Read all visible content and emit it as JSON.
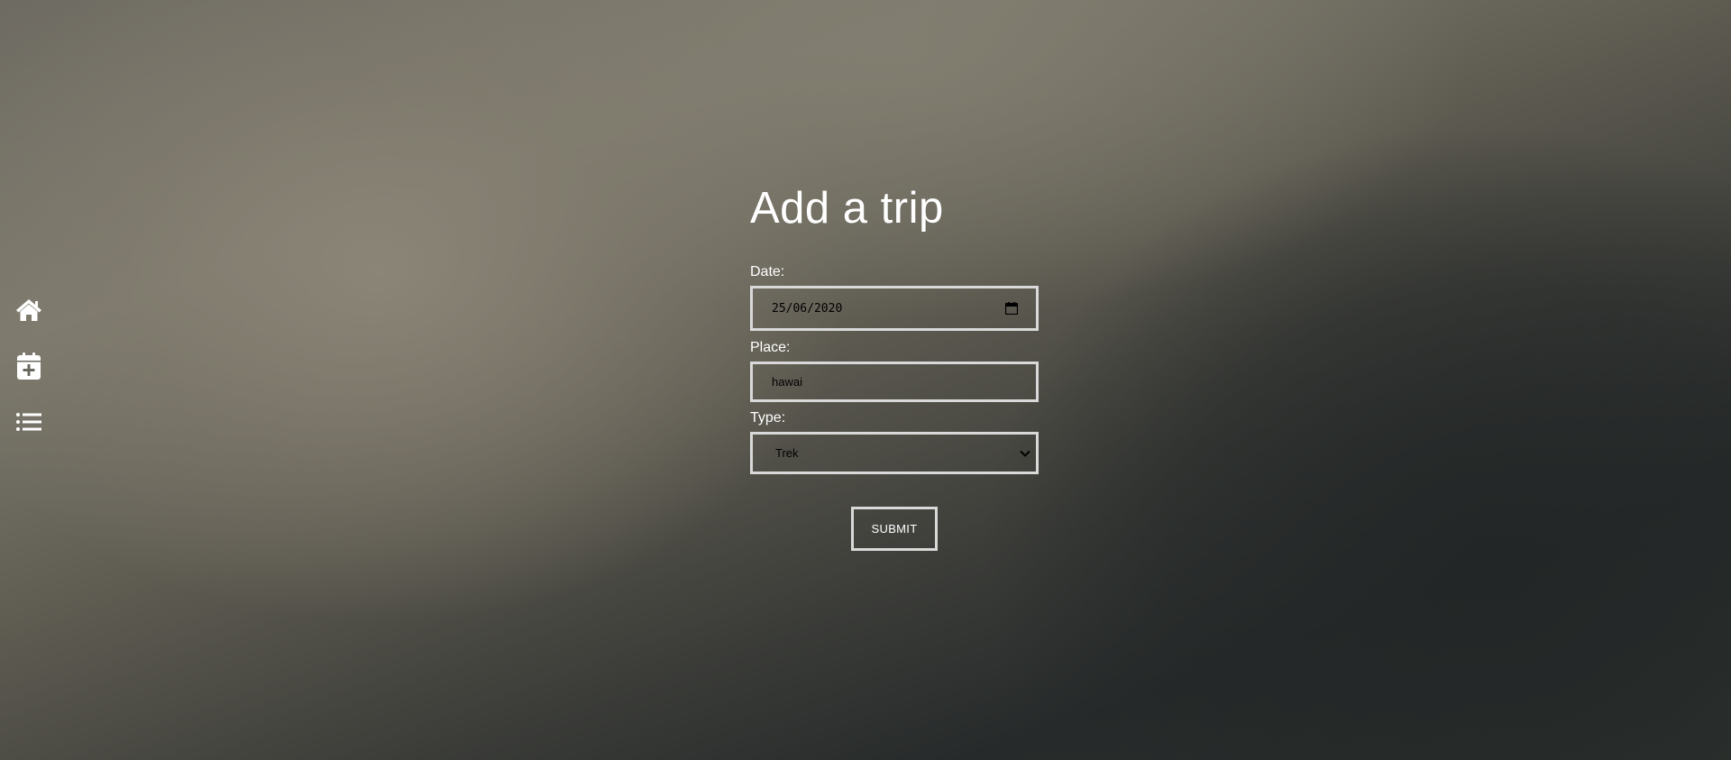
{
  "nav": {
    "items": [
      {
        "icon": "home-icon"
      },
      {
        "icon": "calendar-plus-icon"
      },
      {
        "icon": "list-icon"
      }
    ]
  },
  "form": {
    "title": "Add a trip",
    "date": {
      "label": "Date:",
      "value": "25/06/2020"
    },
    "place": {
      "label": "Place:",
      "value": "hawai"
    },
    "type": {
      "label": "Type:",
      "value": "Trek"
    },
    "submit_label": "SUBMIT"
  },
  "colors": {
    "text": "#ffffff",
    "field_border": "#d9d9d9"
  }
}
